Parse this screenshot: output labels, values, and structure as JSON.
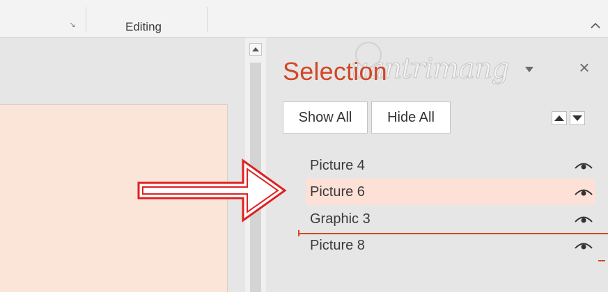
{
  "ribbon": {
    "dialog_launcher_glyph": "↘",
    "group_label": "Editing",
    "collapse_icon": "chevron-up-icon"
  },
  "watermark": {
    "text": "uantrimang"
  },
  "selection_pane": {
    "title": "Selection",
    "close_glyph": "×",
    "show_all_label": "Show All",
    "hide_all_label": "Hide All",
    "items": [
      {
        "label": "Picture 4",
        "selected": false,
        "visible": true
      },
      {
        "label": "Picture 6",
        "selected": true,
        "visible": true
      },
      {
        "label": "Graphic 3",
        "selected": false,
        "visible": true
      },
      {
        "label": "Picture 8",
        "selected": false,
        "visible": true
      }
    ]
  },
  "colors": {
    "accent": "#d24726",
    "selected_row": "#fde0d6",
    "slide_background": "#fbe5d9",
    "arrow": "#e02020"
  }
}
